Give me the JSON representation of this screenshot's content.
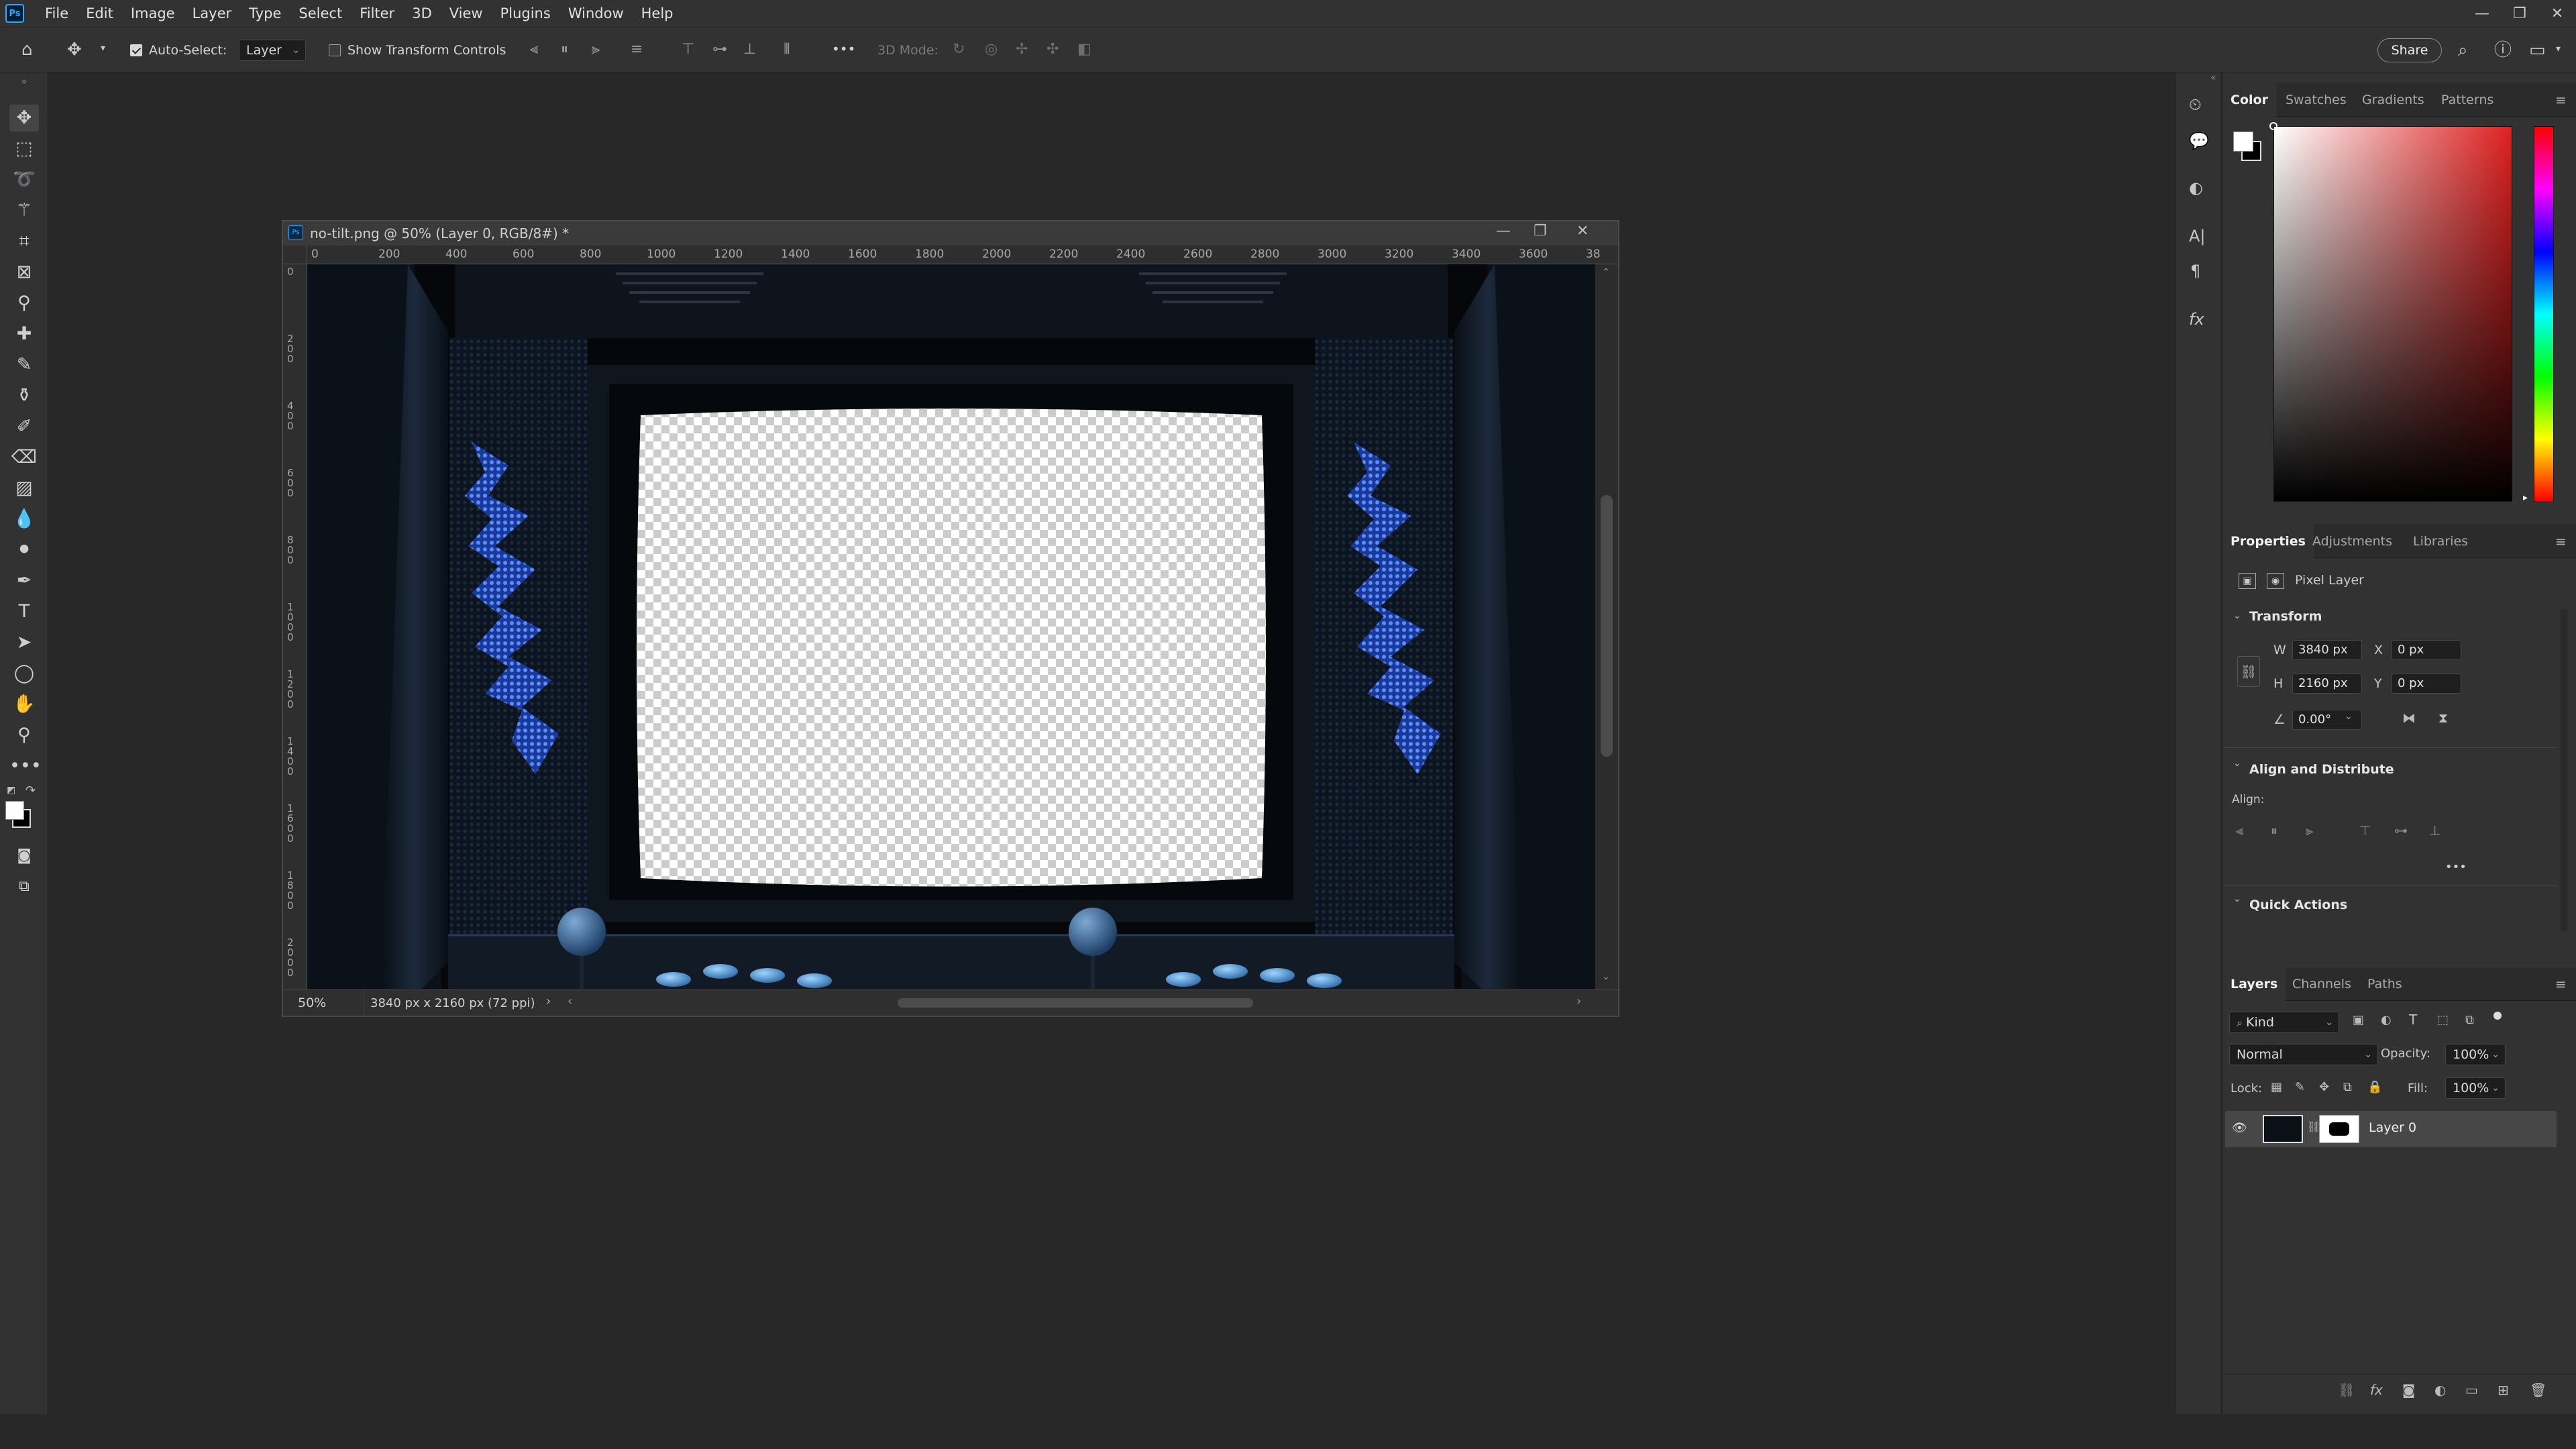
{
  "menu": [
    "File",
    "Edit",
    "Image",
    "Layer",
    "Type",
    "Select",
    "Filter",
    "3D",
    "View",
    "Plugins",
    "Window",
    "Help"
  ],
  "options": {
    "auto_select_label": "Auto-Select:",
    "auto_select_value": "Layer",
    "show_transform_label": "Show Transform Controls",
    "mode_3d_label": "3D Mode:",
    "more": "•••",
    "share_label": "Share"
  },
  "document": {
    "title": "no-tilt.png @ 50% (Layer 0, RGB/8#) *",
    "zoom": "50%",
    "info": "3840 px x 2160 px (72 ppi)",
    "h_ruler": [
      "0",
      "200",
      "400",
      "600",
      "800",
      "1000",
      "1200",
      "1400",
      "1600",
      "1800",
      "2000",
      "2200",
      "2400",
      "2600",
      "2800",
      "3000",
      "3200",
      "3400",
      "3600",
      "38"
    ],
    "v_ruler": [
      "0",
      "200",
      "400",
      "600",
      "800",
      "1000",
      "1200",
      "1400",
      "1600",
      "1800",
      "2000"
    ]
  },
  "color_panel": {
    "tabs": [
      "Color",
      "Swatches",
      "Gradients",
      "Patterns"
    ],
    "foreground": "#ffffff",
    "background": "#000000",
    "hue_color": "#e02020"
  },
  "properties": {
    "tabs": [
      "Properties",
      "Adjustments",
      "Libraries"
    ],
    "kind": "Pixel Layer",
    "transform_title": "Transform",
    "w_label": "W",
    "w": "3840 px",
    "h_label": "H",
    "h": "2160 px",
    "x_label": "X",
    "x": "0 px",
    "y_label": "Y",
    "y": "0 px",
    "angle": "0.00°",
    "align_title": "Align and Distribute",
    "align_label": "Align:",
    "align_more": "•••",
    "quick_title": "Quick Actions"
  },
  "layers": {
    "tabs": [
      "Layers",
      "Channels",
      "Paths"
    ],
    "kind_label": "Kind",
    "blend_mode": "Normal",
    "opacity_label": "Opacity:",
    "opacity": "100%",
    "lock_label": "Lock:",
    "fill_label": "Fill:",
    "fill": "100%",
    "items": [
      {
        "name": "Layer 0"
      }
    ]
  }
}
